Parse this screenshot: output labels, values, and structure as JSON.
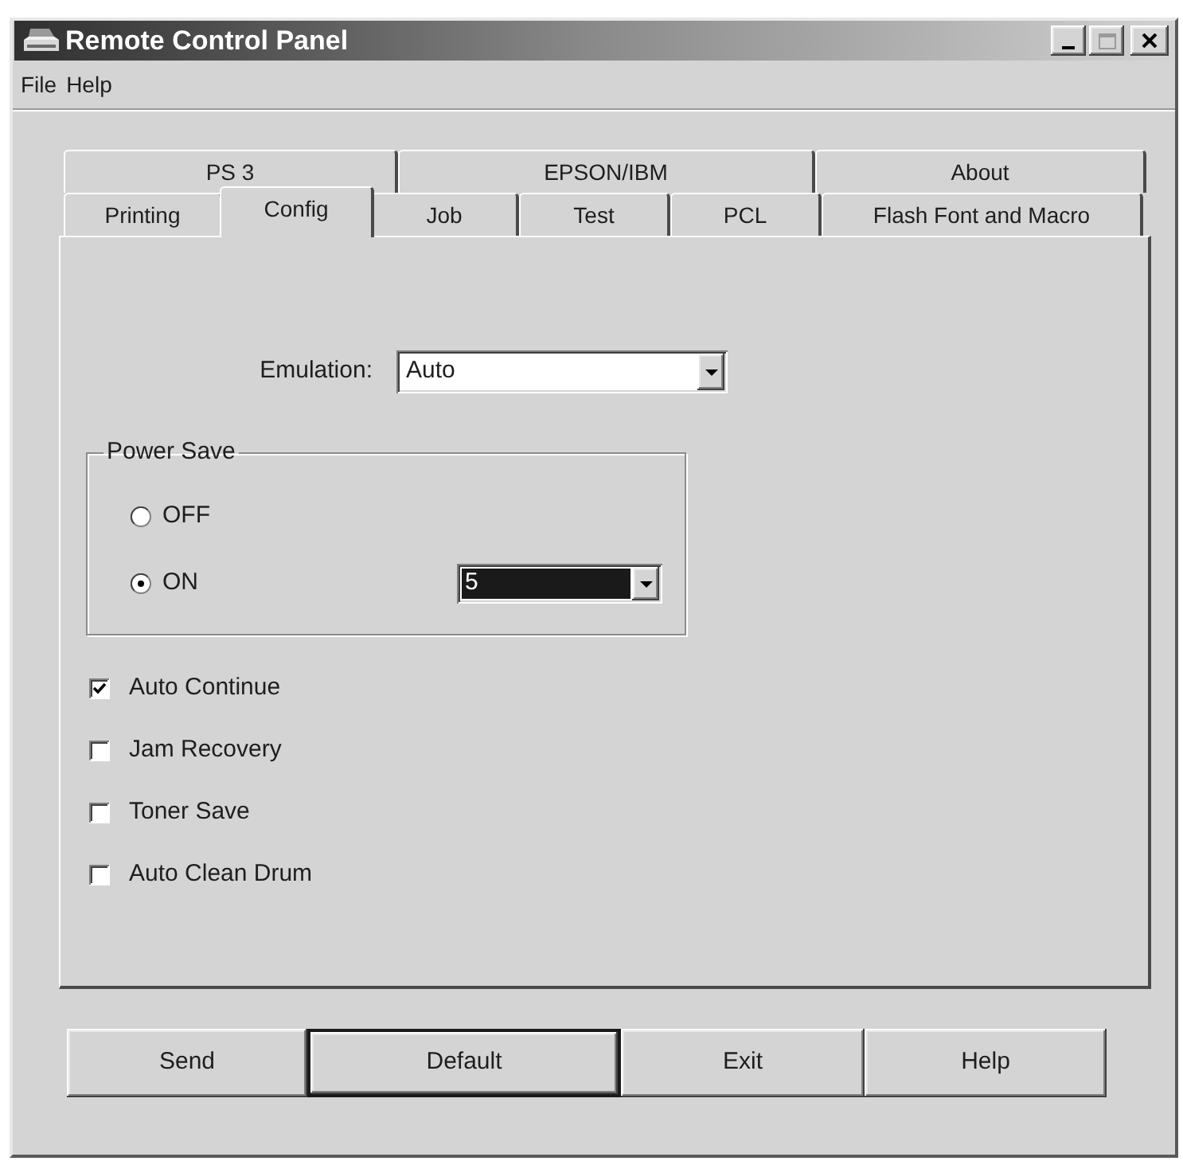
{
  "window": {
    "title": "Remote Control Panel",
    "maximize_disabled": true
  },
  "menu": [
    "File",
    "Help"
  ],
  "tabs": {
    "back_row": [
      {
        "label": "PS 3",
        "selected": false
      },
      {
        "label": "EPSON/IBM",
        "selected": false
      },
      {
        "label": "About",
        "selected": false
      }
    ],
    "front_row": [
      {
        "label": "Printing",
        "selected": false
      },
      {
        "label": "Config",
        "selected": true
      },
      {
        "label": "Job",
        "selected": false
      },
      {
        "label": "Test",
        "selected": false
      },
      {
        "label": "PCL",
        "selected": false
      },
      {
        "label": "Flash Font and Macro",
        "selected": false
      }
    ]
  },
  "emulation": {
    "label": "Emulation:",
    "value": "Auto"
  },
  "power_save": {
    "title": "Power Save",
    "options": [
      {
        "label": "OFF",
        "selected": false
      },
      {
        "label": "ON",
        "selected": true,
        "timeout": {
          "value": "5",
          "focused": true
        }
      }
    ]
  },
  "checkboxes": [
    {
      "label": "Auto Continue",
      "checked": true
    },
    {
      "label": "Jam Recovery",
      "checked": false
    },
    {
      "label": "Toner Save",
      "checked": false
    },
    {
      "label": "Auto Clean Drum",
      "checked": false
    }
  ],
  "buttons": [
    {
      "label": "Send",
      "default": false
    },
    {
      "label": "Default",
      "default": true
    },
    {
      "label": "Exit",
      "default": false
    },
    {
      "label": "Help",
      "default": false
    }
  ]
}
